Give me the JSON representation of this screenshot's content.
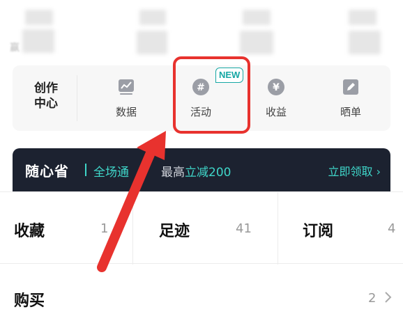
{
  "top_fragment": "赢",
  "creator_center": {
    "title_line1": "创作",
    "title_line2": "中心",
    "tools": [
      {
        "label": "数据",
        "icon": "chart-icon"
      },
      {
        "label": "活动",
        "icon": "hashtag-icon",
        "badge": "NEW"
      },
      {
        "label": "收益",
        "icon": "yen-icon"
      },
      {
        "label": "晒单",
        "icon": "edit-icon"
      }
    ]
  },
  "promo": {
    "brand": "随心省",
    "text_a": "全场通",
    "text_b": "最高",
    "text_c": "立减200",
    "claim": "立即领取 ›"
  },
  "stats": [
    {
      "label": "收藏",
      "count": "1"
    },
    {
      "label": "足迹",
      "count": "41"
    },
    {
      "label": "订阅",
      "count": "4"
    }
  ],
  "purchase": {
    "label": "购买",
    "count": "2"
  },
  "colors": {
    "highlight": "#e8322e",
    "accent": "#16a7a4",
    "promo_bg": "#1c2230"
  }
}
